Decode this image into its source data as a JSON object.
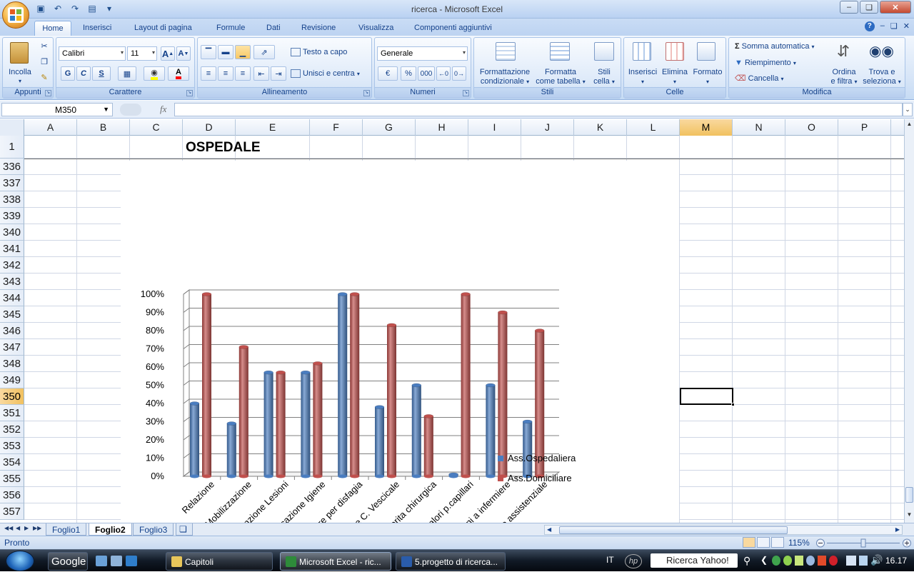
{
  "window": {
    "title": "ricerca - Microsoft Excel"
  },
  "tabs": [
    "Home",
    "Inserisci",
    "Layout di pagina",
    "Formule",
    "Dati",
    "Revisione",
    "Visualizza",
    "Componenti aggiuntivi"
  ],
  "ribbon": {
    "groups": {
      "appunti": "Appunti",
      "carattere": "Carattere",
      "allineamento": "Allineamento",
      "numeri": "Numeri",
      "stili": "Stili",
      "celle": "Celle",
      "modifica": "Modifica"
    },
    "incolla": "Incolla",
    "font_name": "Calibri",
    "font_size": "11",
    "bold": "G",
    "italic": "C",
    "underline": "S",
    "testo_a_capo": "Testo a capo",
    "unisci": "Unisci e centra",
    "number_format": "Generale",
    "percent": "%",
    "thousands": "000",
    "formattazione_1": "Formattazione",
    "formattazione_2": "condizionale",
    "formatta_1": "Formatta",
    "formatta_2": "come tabella",
    "stili_1": "Stili",
    "stili_2": "cella",
    "inserisci": "Inserisci",
    "elimina": "Elimina",
    "formato": "Formato",
    "somma": "Somma automatica",
    "riempimento": "Riempimento",
    "cancella": "Cancella",
    "ordina_1": "Ordina",
    "ordina_2": "e filtra",
    "trova_1": "Trova e",
    "trova_2": "seleziona"
  },
  "formula_bar": {
    "name_box": "M350",
    "fx": "fx",
    "formula": ""
  },
  "columns": [
    "A",
    "B",
    "C",
    "D",
    "E",
    "F",
    "G",
    "H",
    "I",
    "J",
    "K",
    "L",
    "M",
    "N",
    "O",
    "P"
  ],
  "selected_column": "M",
  "rows": [
    "1",
    "336",
    "337",
    "338",
    "339",
    "340",
    "341",
    "342",
    "343",
    "344",
    "345",
    "346",
    "347",
    "348",
    "349",
    "350",
    "351",
    "352",
    "353",
    "354",
    "355",
    "356",
    "357"
  ],
  "selected_row": "350",
  "cells": {
    "D1": "OSPEDALE"
  },
  "chart_data": {
    "type": "bar",
    "categories": [
      "Relazione",
      "Educazione Mobilizzazione",
      "Prevenzione Lesioni",
      "Educazione Igiene",
      "Educazione alimentare per disfagia",
      "Educazione gestione C. Vescicale",
      "Educazione ferita chirurgica",
      "Informazione valori p.capillari",
      "Comunicazione emozioni a infermiere",
      "Coinvolgimento assistenziale"
    ],
    "series": [
      {
        "name": "Ass.Ospedaliera",
        "color": "#4a7dc0",
        "values": [
          40,
          29,
          57,
          57,
          100,
          38,
          50,
          1,
          50,
          30
        ]
      },
      {
        "name": "Ass.Domiciliare",
        "color": "#c0504d",
        "values": [
          100,
          71,
          57,
          62,
          100,
          83,
          33,
          100,
          90,
          80
        ]
      }
    ],
    "ylim": [
      0,
      100
    ],
    "yticks": [
      "0%",
      "10%",
      "20%",
      "30%",
      "40%",
      "50%",
      "60%",
      "70%",
      "80%",
      "90%",
      "100%"
    ],
    "grid": true,
    "legend": "bottom-right"
  },
  "sheets": [
    "Foglio1",
    "Foglio2",
    "Foglio3"
  ],
  "active_sheet": "Foglio2",
  "status": {
    "ready": "Pronto",
    "zoom": "115%"
  },
  "taskbar": {
    "google": "Google",
    "items": [
      "Capitoli",
      "Microsoft Excel - ric...",
      "5.progetto di ricerca..."
    ],
    "lang": "IT",
    "search": "Ricerca Yahoo!",
    "clock": "16.17"
  }
}
